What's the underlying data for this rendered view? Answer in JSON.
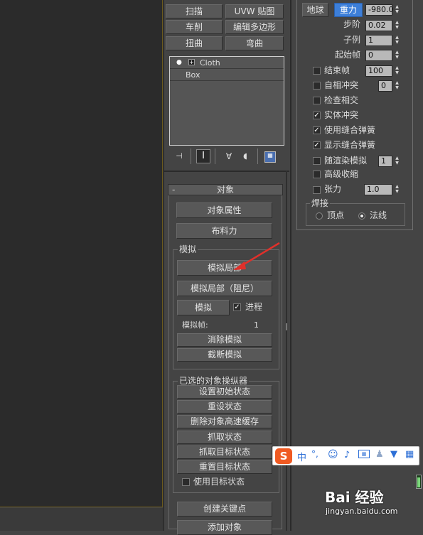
{
  "modifier_buttons": [
    {
      "label": "扫描"
    },
    {
      "label": "UVW 贴图"
    },
    {
      "label": "车削"
    },
    {
      "label": "编辑多边形"
    },
    {
      "label": "扭曲"
    },
    {
      "label": "弯曲"
    }
  ],
  "stack": {
    "items": [
      "Cloth",
      "Box"
    ]
  },
  "object_rollout": {
    "title": "对象",
    "collapse": "-",
    "object_props": "对象属性",
    "cloth_forces": "布料力"
  },
  "simulate_group": {
    "title": "模拟",
    "sim_local": "模拟局部",
    "sim_local_damped": "模拟局部（阻尼）",
    "simulate": "模拟",
    "progress_label": "进程",
    "progress_checked": true,
    "sim_frame_label": "模拟帧:",
    "sim_frame_value": "1",
    "erase_sim": "消除模拟",
    "truncate_sim": "截断模拟"
  },
  "selected_group": {
    "title": "已选的对象操纵器",
    "set_init": "设置初始状态",
    "reset_state": "重设状态",
    "delete_cache": "删除对象高速缓存",
    "grab_state": "抓取状态",
    "grab_target": "抓取目标状态",
    "reset_target": "重置目标状态",
    "use_target_label": "使用目标状态"
  },
  "bottom_buttons": {
    "create_key": "创建关键点",
    "add_object": "添加对象"
  },
  "sim_params": {
    "earth_label": "地球",
    "gravity_label": "重力",
    "gravity_value": "-980.0",
    "step_label": "步阶",
    "step_value": "0.02",
    "subsample_label": "子例",
    "subsample_value": "1",
    "start_frame_label": "起始帧",
    "start_frame_value": "0",
    "end_frame_label": "结束帧",
    "end_frame_value": "100",
    "self_collide_label": "自相冲突",
    "self_collide_value": "0",
    "check_intersect_label": "检查相交",
    "solid_collide_label": "实体冲突",
    "use_sewing_label": "使用缝合弹簧",
    "show_sewing_label": "显示缝合弹簧",
    "render_sim_label": "随渲染模拟",
    "render_sim_value": "1",
    "advanced_pinch_label": "高级收缩",
    "tension_label": "张力",
    "tension_value": "1.0",
    "weld_title": "焊接",
    "vertex_label": "顶点",
    "normal_label": "法线"
  },
  "checkbox_states": {
    "end_frame": false,
    "self_collide": false,
    "check_intersect": false,
    "solid_collide": true,
    "use_sewing": true,
    "show_sewing": true,
    "render_sim": false,
    "advanced_pinch": false,
    "tension": false,
    "use_target": false
  },
  "ime_toolbar": {
    "logo": "S",
    "chinese": "中",
    "punct": "°,"
  },
  "watermark": {
    "brand": "Bai 经验",
    "url": "jingyan.baidu.com"
  },
  "colors": {
    "accent_blue": "#3d7fd9",
    "panel_bg": "#444444",
    "viewport_bg": "#2b2b2b",
    "annotation_arrow": "#e0302a",
    "ime_accent": "#f05a22"
  }
}
